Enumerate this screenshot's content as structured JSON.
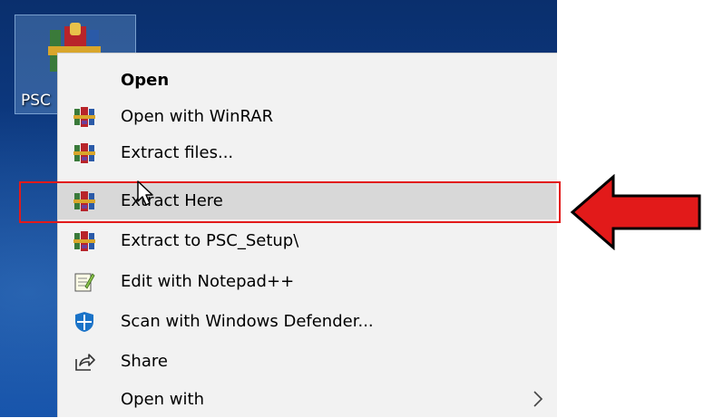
{
  "desktop_icon": {
    "label": "PSC",
    "icon": "winrar-archive-icon"
  },
  "context_menu": {
    "items": [
      {
        "label": "Open",
        "icon": "none",
        "bold": true
      },
      {
        "label": "Open with WinRAR",
        "icon": "winrar-icon"
      },
      {
        "label": "Extract files...",
        "icon": "winrar-icon"
      },
      {
        "label": "Extract Here",
        "icon": "winrar-icon",
        "hovered": true
      },
      {
        "label": "Extract to PSC_Setup\\",
        "icon": "winrar-icon"
      },
      {
        "label": "Edit with Notepad++",
        "icon": "notepad-plus-plus-icon"
      },
      {
        "label": "Scan with Windows Defender...",
        "icon": "windows-defender-icon"
      },
      {
        "label": "Share",
        "icon": "share-icon"
      },
      {
        "label": "Open with",
        "icon": "none",
        "submenu": true
      }
    ]
  },
  "annotation": {
    "highlight_color": "#e21a1a",
    "arrow_color": "#e21a1a"
  }
}
